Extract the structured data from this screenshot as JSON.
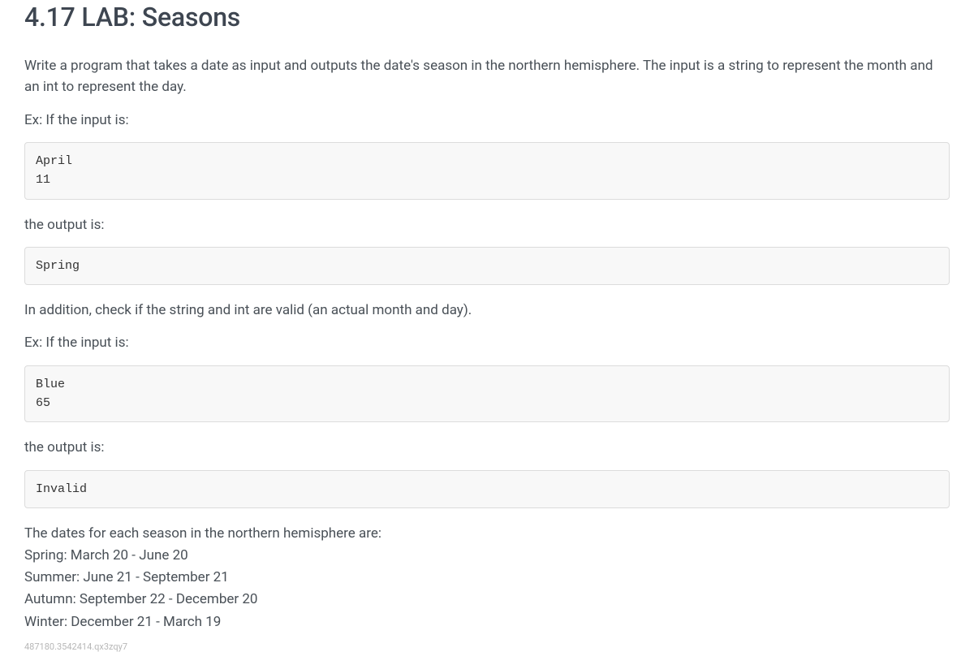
{
  "title": "4.17 LAB: Seasons",
  "intro": "Write a program that takes a date as input and outputs the date's season in the northern hemisphere. The input is a string to represent the month and an int to represent the day.",
  "ex1_label": "Ex: If the input is:",
  "ex1_code": "April\n11",
  "out1_label": "the output is:",
  "out1_code": "Spring",
  "validate": "In addition, check if the string and int are valid (an actual month and day).",
  "ex2_label": "Ex: If the input is:",
  "ex2_code": "Blue\n65",
  "out2_label": "the output is:",
  "out2_code": "Invalid",
  "seasons": "The dates for each season in the northern hemisphere are:\nSpring: March 20 - June 20\nSummer: June 21 - September 21\nAutumn: September 22 - December 20\nWinter: December 21 - March 19",
  "footer_id": "487180.3542414.qx3zqy7"
}
